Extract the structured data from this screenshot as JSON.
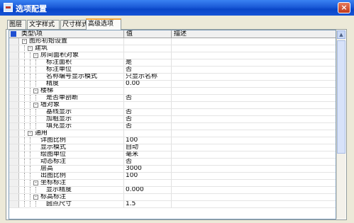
{
  "window": {
    "title": "选项配置",
    "close_glyph": "×"
  },
  "tabs": [
    "图层",
    "文字样式",
    "尺寸样式",
    "高级选项"
  ],
  "columns": {
    "name": "类型\\项",
    "value": "值",
    "desc": "描述"
  },
  "rows": [
    {
      "name": "图形初始设置",
      "value": ""
    },
    {
      "name": "建筑",
      "value": ""
    },
    {
      "name": "房间面积对象",
      "value": ""
    },
    {
      "name": "标注面积",
      "value": "是"
    },
    {
      "name": "标注单位",
      "value": "否"
    },
    {
      "name": "名称编号显示模式",
      "value": "只显示名称"
    },
    {
      "name": "精度",
      "value": "0.00"
    },
    {
      "name": "楼梯",
      "value": ""
    },
    {
      "name": "是否单剖断",
      "value": "否"
    },
    {
      "name": "墙对象",
      "value": ""
    },
    {
      "name": "基线显示",
      "value": "否"
    },
    {
      "name": "加粗显示",
      "value": "否"
    },
    {
      "name": "填充显示",
      "value": "否"
    },
    {
      "name": "通用",
      "value": ""
    },
    {
      "name": "详图比例",
      "value": "100"
    },
    {
      "name": "显示模式",
      "value": "自动"
    },
    {
      "name": "绘图单位",
      "value": "毫米"
    },
    {
      "name": "动态标注",
      "value": "否"
    },
    {
      "name": "层高",
      "value": "3000"
    },
    {
      "name": "出图比例",
      "value": "100"
    },
    {
      "name": "坐标标注",
      "value": ""
    },
    {
      "name": "显示精度",
      "value": "0.000"
    },
    {
      "name": "标高标注",
      "value": ""
    },
    {
      "name": "圆点尺寸",
      "value": "1.5"
    }
  ]
}
